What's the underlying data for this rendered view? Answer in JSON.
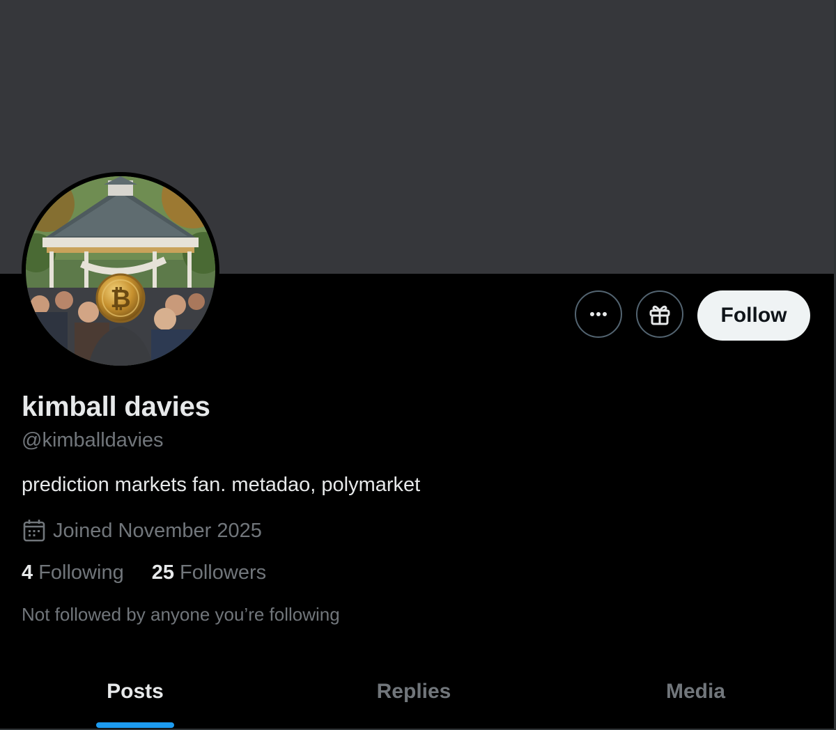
{
  "profile": {
    "display_name": "kimball davies",
    "handle": "@kimballdavies",
    "bio": "prediction markets fan. metadao, polymarket",
    "joined": "Joined November 2025",
    "following_count": "4",
    "following_label": " Following",
    "followers_count": "25",
    "followers_label": " Followers",
    "followed_by_note": "Not followed by anyone you’re following"
  },
  "actions": {
    "more_icon": "more-horizontal-icon",
    "gift_icon": "gift-icon",
    "follow_label": "Follow"
  },
  "tabs": [
    {
      "label": "Posts",
      "active": true
    },
    {
      "label": "Replies",
      "active": false
    },
    {
      "label": "Media",
      "active": false
    }
  ],
  "colors": {
    "banner": "#36373b",
    "background": "#000000",
    "primary_text": "#e7e9ea",
    "secondary_text": "#71767b",
    "accent": "#1d9bf0",
    "follow_button_bg": "#eff3f4"
  },
  "icons": {
    "calendar": "calendar-icon"
  }
}
